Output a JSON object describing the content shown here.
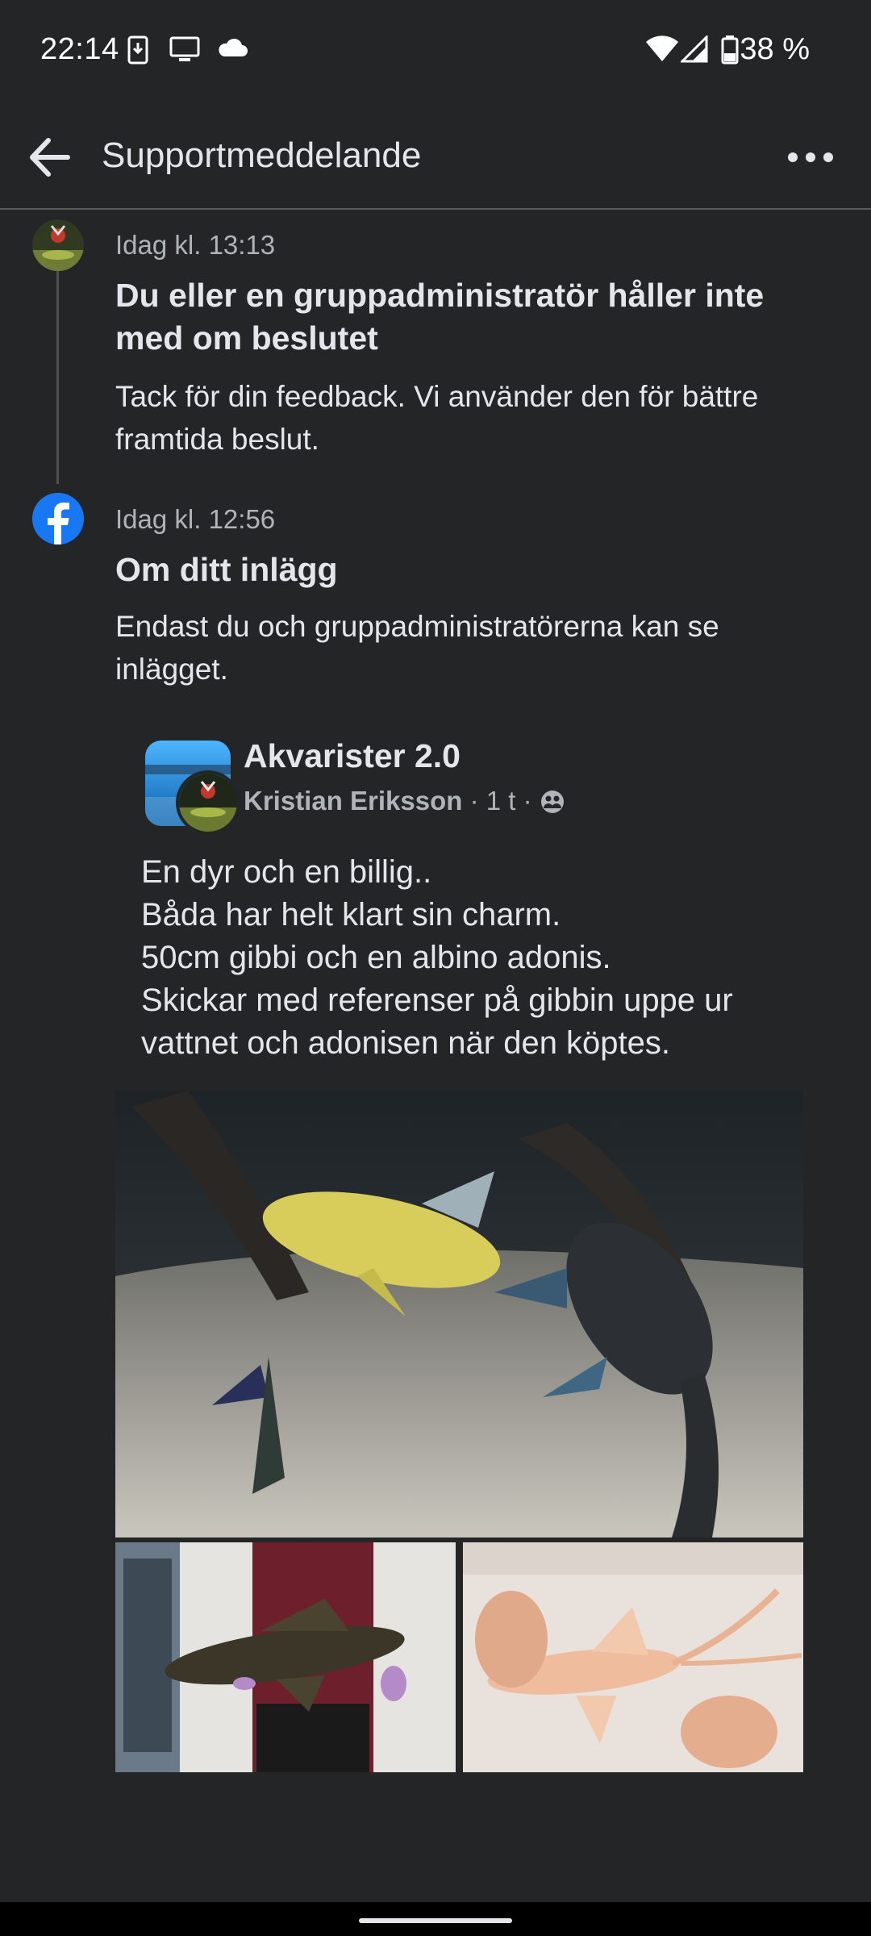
{
  "status_bar": {
    "time": "22:14",
    "battery": "38 %",
    "icons": [
      "download-icon",
      "cast-icon",
      "cloud-icon",
      "wifi-icon",
      "signal-icon",
      "battery-icon"
    ]
  },
  "app_bar": {
    "title": "Supportmeddelande"
  },
  "messages": [
    {
      "time": "Idag kl. 13:13",
      "title": "Du eller en gruppadministratör håller inte med om beslutet",
      "body": "Tack för din feedback. Vi använder den för bättre framtida beslut."
    },
    {
      "time": "Idag kl. 12:56",
      "title": "Om ditt inlägg",
      "body": "Endast du och gruppadministratörerna kan se inlägget."
    }
  ],
  "post": {
    "group": "Akvarister 2.0",
    "author": "Kristian Eriksson",
    "age": "1 t",
    "audience_icon": "group-privacy-icon",
    "text_lines": [
      "En dyr och en billig..",
      "Båda har helt klart sin charm.",
      "50cm gibbi och en albino adonis.",
      "Skickar med referenser på gibbin uppe ur",
      "vattnet och adonisen när den köptes."
    ]
  },
  "colors": {
    "background": "#242526",
    "text": "#e4e6eb",
    "secondary_text": "#b0b3b8",
    "facebook_blue": "#1877f2"
  }
}
